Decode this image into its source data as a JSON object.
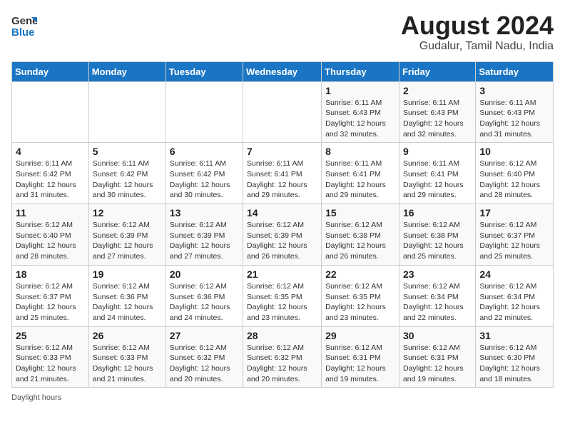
{
  "header": {
    "logo_line1": "General",
    "logo_line2": "Blue",
    "month_year": "August 2024",
    "location": "Gudalur, Tamil Nadu, India"
  },
  "days_of_week": [
    "Sunday",
    "Monday",
    "Tuesday",
    "Wednesday",
    "Thursday",
    "Friday",
    "Saturday"
  ],
  "weeks": [
    [
      {
        "day": "",
        "info": ""
      },
      {
        "day": "",
        "info": ""
      },
      {
        "day": "",
        "info": ""
      },
      {
        "day": "",
        "info": ""
      },
      {
        "day": "1",
        "info": "Sunrise: 6:11 AM\nSunset: 6:43 PM\nDaylight: 12 hours\nand 32 minutes."
      },
      {
        "day": "2",
        "info": "Sunrise: 6:11 AM\nSunset: 6:43 PM\nDaylight: 12 hours\nand 32 minutes."
      },
      {
        "day": "3",
        "info": "Sunrise: 6:11 AM\nSunset: 6:43 PM\nDaylight: 12 hours\nand 31 minutes."
      }
    ],
    [
      {
        "day": "4",
        "info": "Sunrise: 6:11 AM\nSunset: 6:42 PM\nDaylight: 12 hours\nand 31 minutes."
      },
      {
        "day": "5",
        "info": "Sunrise: 6:11 AM\nSunset: 6:42 PM\nDaylight: 12 hours\nand 30 minutes."
      },
      {
        "day": "6",
        "info": "Sunrise: 6:11 AM\nSunset: 6:42 PM\nDaylight: 12 hours\nand 30 minutes."
      },
      {
        "day": "7",
        "info": "Sunrise: 6:11 AM\nSunset: 6:41 PM\nDaylight: 12 hours\nand 29 minutes."
      },
      {
        "day": "8",
        "info": "Sunrise: 6:11 AM\nSunset: 6:41 PM\nDaylight: 12 hours\nand 29 minutes."
      },
      {
        "day": "9",
        "info": "Sunrise: 6:11 AM\nSunset: 6:41 PM\nDaylight: 12 hours\nand 29 minutes."
      },
      {
        "day": "10",
        "info": "Sunrise: 6:12 AM\nSunset: 6:40 PM\nDaylight: 12 hours\nand 28 minutes."
      }
    ],
    [
      {
        "day": "11",
        "info": "Sunrise: 6:12 AM\nSunset: 6:40 PM\nDaylight: 12 hours\nand 28 minutes."
      },
      {
        "day": "12",
        "info": "Sunrise: 6:12 AM\nSunset: 6:39 PM\nDaylight: 12 hours\nand 27 minutes."
      },
      {
        "day": "13",
        "info": "Sunrise: 6:12 AM\nSunset: 6:39 PM\nDaylight: 12 hours\nand 27 minutes."
      },
      {
        "day": "14",
        "info": "Sunrise: 6:12 AM\nSunset: 6:39 PM\nDaylight: 12 hours\nand 26 minutes."
      },
      {
        "day": "15",
        "info": "Sunrise: 6:12 AM\nSunset: 6:38 PM\nDaylight: 12 hours\nand 26 minutes."
      },
      {
        "day": "16",
        "info": "Sunrise: 6:12 AM\nSunset: 6:38 PM\nDaylight: 12 hours\nand 25 minutes."
      },
      {
        "day": "17",
        "info": "Sunrise: 6:12 AM\nSunset: 6:37 PM\nDaylight: 12 hours\nand 25 minutes."
      }
    ],
    [
      {
        "day": "18",
        "info": "Sunrise: 6:12 AM\nSunset: 6:37 PM\nDaylight: 12 hours\nand 25 minutes."
      },
      {
        "day": "19",
        "info": "Sunrise: 6:12 AM\nSunset: 6:36 PM\nDaylight: 12 hours\nand 24 minutes."
      },
      {
        "day": "20",
        "info": "Sunrise: 6:12 AM\nSunset: 6:36 PM\nDaylight: 12 hours\nand 24 minutes."
      },
      {
        "day": "21",
        "info": "Sunrise: 6:12 AM\nSunset: 6:35 PM\nDaylight: 12 hours\nand 23 minutes."
      },
      {
        "day": "22",
        "info": "Sunrise: 6:12 AM\nSunset: 6:35 PM\nDaylight: 12 hours\nand 23 minutes."
      },
      {
        "day": "23",
        "info": "Sunrise: 6:12 AM\nSunset: 6:34 PM\nDaylight: 12 hours\nand 22 minutes."
      },
      {
        "day": "24",
        "info": "Sunrise: 6:12 AM\nSunset: 6:34 PM\nDaylight: 12 hours\nand 22 minutes."
      }
    ],
    [
      {
        "day": "25",
        "info": "Sunrise: 6:12 AM\nSunset: 6:33 PM\nDaylight: 12 hours\nand 21 minutes."
      },
      {
        "day": "26",
        "info": "Sunrise: 6:12 AM\nSunset: 6:33 PM\nDaylight: 12 hours\nand 21 minutes."
      },
      {
        "day": "27",
        "info": "Sunrise: 6:12 AM\nSunset: 6:32 PM\nDaylight: 12 hours\nand 20 minutes."
      },
      {
        "day": "28",
        "info": "Sunrise: 6:12 AM\nSunset: 6:32 PM\nDaylight: 12 hours\nand 20 minutes."
      },
      {
        "day": "29",
        "info": "Sunrise: 6:12 AM\nSunset: 6:31 PM\nDaylight: 12 hours\nand 19 minutes."
      },
      {
        "day": "30",
        "info": "Sunrise: 6:12 AM\nSunset: 6:31 PM\nDaylight: 12 hours\nand 19 minutes."
      },
      {
        "day": "31",
        "info": "Sunrise: 6:12 AM\nSunset: 6:30 PM\nDaylight: 12 hours\nand 18 minutes."
      }
    ]
  ],
  "footer": {
    "note": "Daylight hours"
  }
}
